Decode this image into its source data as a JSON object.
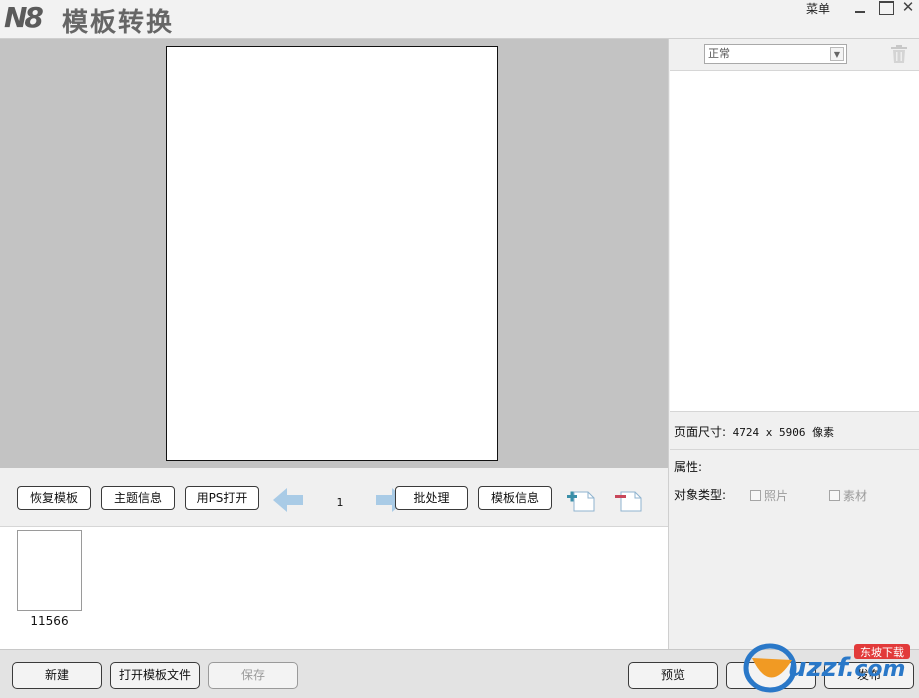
{
  "titlebar": {
    "logo": "N8",
    "title": "模板转换",
    "menu_label": "菜单"
  },
  "toolbar": {
    "restore_template": "恢复模板",
    "theme_info": "主题信息",
    "open_with_ps": "用PS打开",
    "page_number": "1",
    "batch_process": "批处理",
    "template_info": "模板信息"
  },
  "thumbnails": [
    {
      "label": "11566"
    }
  ],
  "right_panel": {
    "blend_mode": "正常",
    "page_size_label": "页面尺寸:",
    "page_size_value": "4724 x 5906 像素",
    "attributes_label": "属性:",
    "object_type_label": "对象类型:",
    "object_types": [
      {
        "label": "照片",
        "checked": false,
        "enabled": false
      },
      {
        "label": "素材",
        "checked": false,
        "enabled": false
      }
    ]
  },
  "bottombar": {
    "new": "新建",
    "open_template_file": "打开模板文件",
    "save": "保存",
    "preview": "预览",
    "publish": "发布"
  },
  "watermark": {
    "text": "uzzf.com",
    "tagline": "东坡下载"
  },
  "colors": {
    "canvas_bg": "#c3c3c3",
    "arrow_blue": "#a9cbe6",
    "delete_red": "#c8475a",
    "add_teal": "#3a8fa8"
  }
}
